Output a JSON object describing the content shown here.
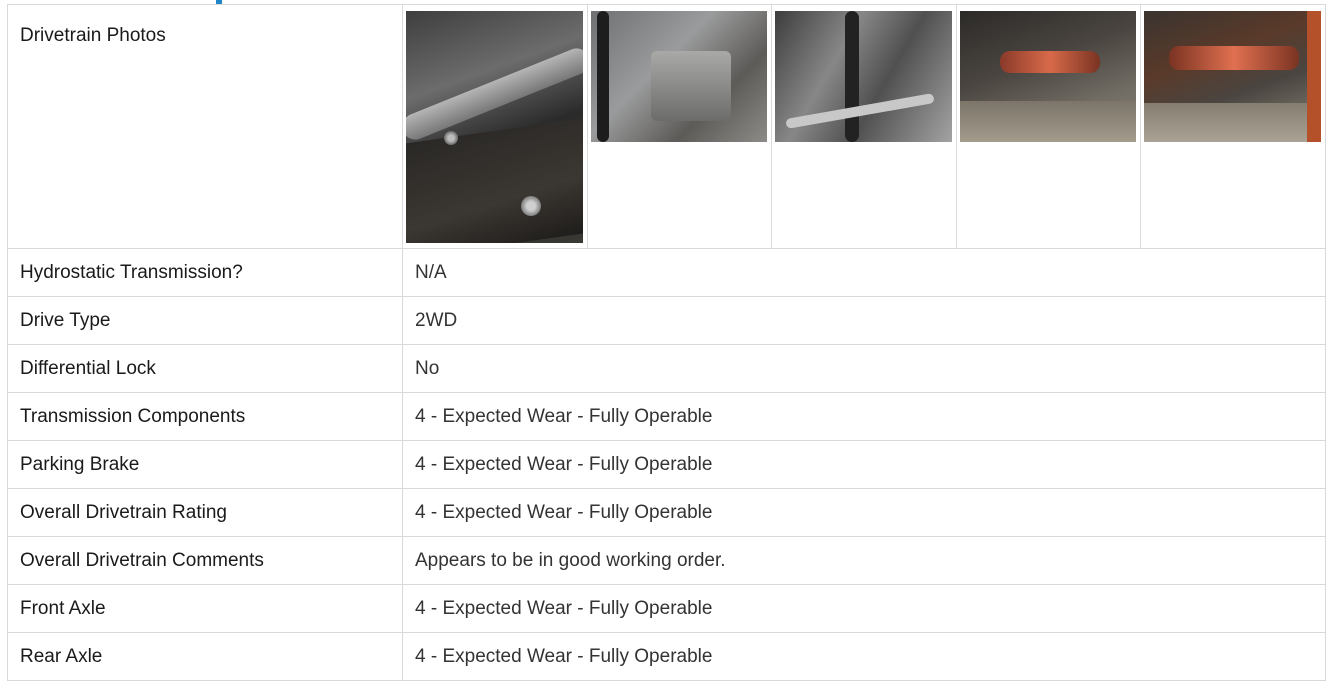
{
  "photos_row": {
    "label": "Drivetrain Photos",
    "photos": [
      {
        "icon": "engine-bay-photo"
      },
      {
        "icon": "transmission-photo"
      },
      {
        "icon": "hoses-photo"
      },
      {
        "icon": "driveshaft-photo"
      },
      {
        "icon": "driveshaft-underside-photo"
      }
    ]
  },
  "rows": [
    {
      "label": "Hydrostatic Transmission?",
      "value": "N/A"
    },
    {
      "label": "Drive Type",
      "value": "2WD"
    },
    {
      "label": "Differential Lock",
      "value": "No"
    },
    {
      "label": "Transmission Components",
      "value": "4 - Expected Wear - Fully Operable"
    },
    {
      "label": "Parking Brake",
      "value": "4 - Expected Wear - Fully Operable"
    },
    {
      "label": "Overall Drivetrain Rating",
      "value": "4 - Expected Wear - Fully Operable"
    },
    {
      "label": "Overall Drivetrain Comments",
      "value": "Appears to be in good working order."
    },
    {
      "label": "Front Axle",
      "value": "4 - Expected Wear - Fully Operable"
    },
    {
      "label": "Rear Axle",
      "value": "4 - Expected Wear - Fully Operable"
    }
  ],
  "colors": {
    "accent": "#1e86c8",
    "border": "#d9d9d9"
  }
}
